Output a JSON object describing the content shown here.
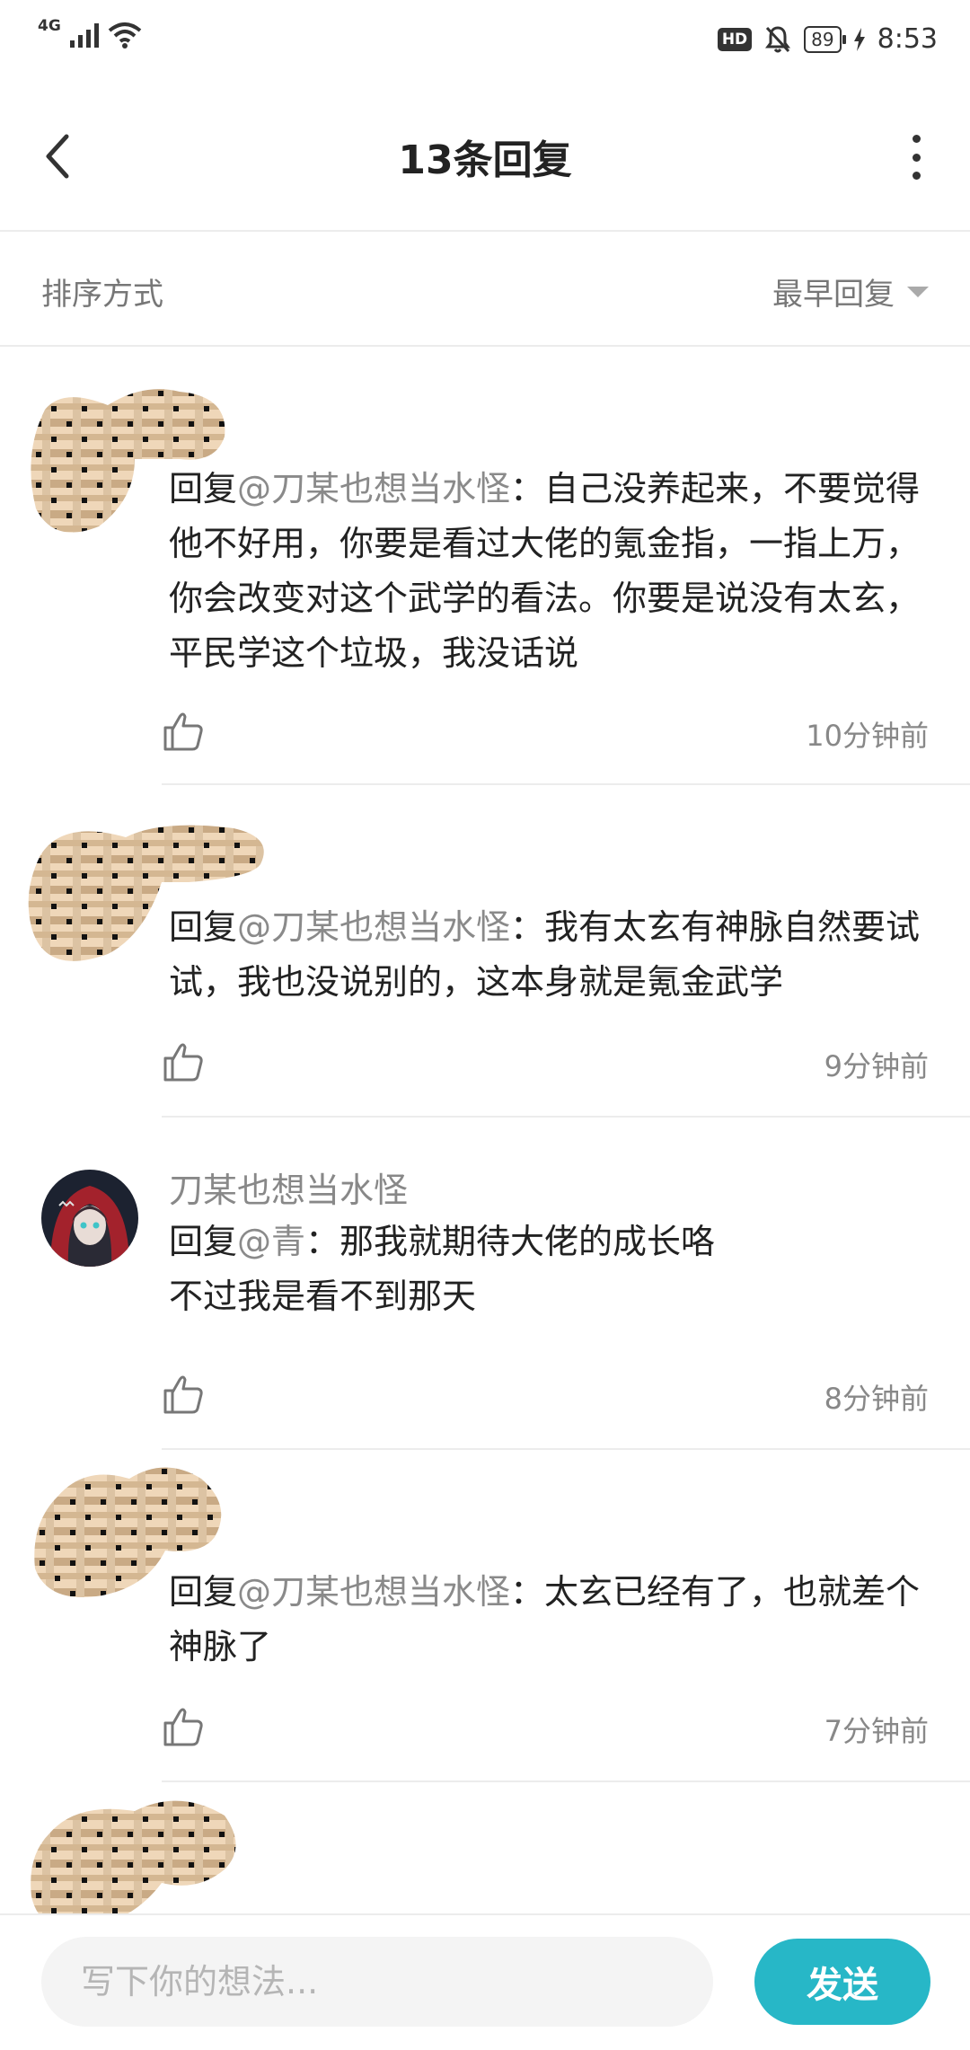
{
  "status_bar": {
    "network": "4G",
    "hd_badge": "HD",
    "battery": "89",
    "time": "8:53"
  },
  "header": {
    "title": "13条回复"
  },
  "sort": {
    "label": "排序方式",
    "selected": "最早回复"
  },
  "comments": [
    {
      "username": "",
      "reply_prefix": "回复",
      "mention": "@刀某也想当水怪",
      "text": "：自己没养起来，不要觉得他不好用，你要是看过大佬的氪金指，一指上万，你会改变对这个武学的看法。你要是说没有太玄，平民学这个垃圾，我没话说",
      "time": "10分钟前"
    },
    {
      "username": "",
      "reply_prefix": "回复",
      "mention": "@刀某也想当水怪",
      "text": "：我有太玄有神脉自然要试试，我也没说别的，这本身就是氪金武学",
      "time": "9分钟前"
    },
    {
      "username": "刀某也想当水怪",
      "reply_prefix": "回复",
      "mention": "@青",
      "text": "：那我就期待大佬的成长咯",
      "text_line2": "不过我是看不到那天",
      "time": "8分钟前"
    },
    {
      "username": "",
      "reply_prefix": "回复",
      "mention": "@刀某也想当水怪",
      "text": "：太玄已经有了，也就差个神脉了",
      "time": "7分钟前"
    }
  ],
  "bottom": {
    "placeholder": "写下你的想法...",
    "send_label": "发送"
  },
  "colors": {
    "accent": "#27b7c7",
    "mention": "#8a8a8a",
    "divider": "#ececec"
  }
}
